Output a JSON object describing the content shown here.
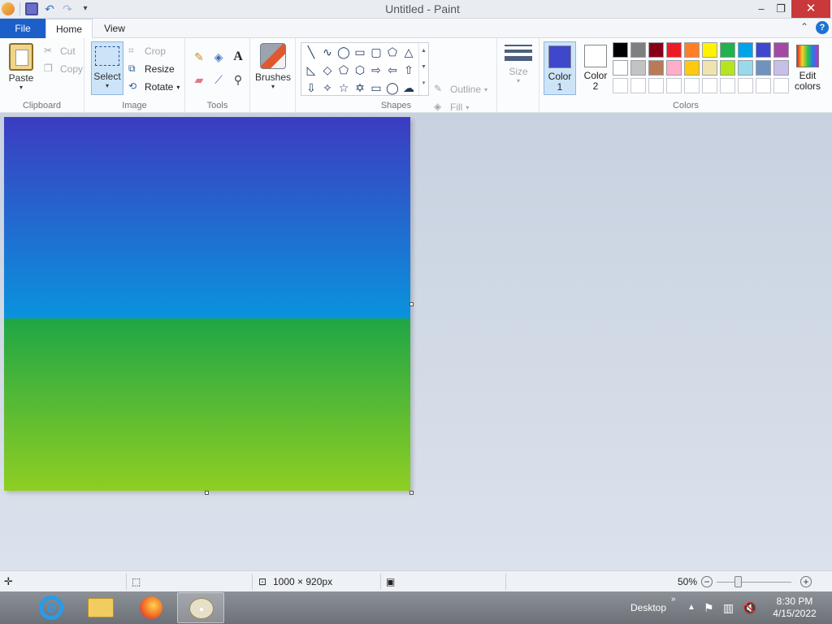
{
  "window": {
    "title": "Untitled - Paint",
    "minimize": "–",
    "maximize": "❐",
    "close": "✕"
  },
  "quick_access": {
    "undo": "↶",
    "redo": "↷",
    "more": "▾"
  },
  "tabs": [
    {
      "label": "File"
    },
    {
      "label": "Home"
    },
    {
      "label": "View"
    }
  ],
  "ribbon_controls": {
    "collapse": "⌃",
    "help": "?"
  },
  "ribbon": {
    "clipboard": {
      "label": "Clipboard",
      "paste": "Paste",
      "cut": "Cut",
      "copy": "Copy"
    },
    "image": {
      "label": "Image",
      "select": "Select",
      "crop": "Crop",
      "resize": "Resize",
      "rotate": "Rotate"
    },
    "tools": {
      "label": "Tools"
    },
    "brushes": {
      "label": "Brushes"
    },
    "shapes": {
      "label": "Shapes",
      "outline": "Outline",
      "fill": "Fill"
    },
    "size": {
      "label": "Size"
    },
    "colors": {
      "label": "Colors",
      "color1_line1": "Color",
      "color1_line2": "1",
      "color2_line1": "Color",
      "color2_line2": "2",
      "edit_line1": "Edit",
      "edit_line2": "colors",
      "color1_value": "#3f48cc",
      "color2_value": "#ffffff",
      "palette": [
        "#000000",
        "#7f7f7f",
        "#880015",
        "#ed1c24",
        "#ff7f27",
        "#fff200",
        "#22b14c",
        "#00a2e8",
        "#3f48cc",
        "#a349a4",
        "#ffffff",
        "#c3c3c3",
        "#b97a57",
        "#ffaec9",
        "#ffc90e",
        "#efe4b0",
        "#b5e61d",
        "#99d9ea",
        "#7092be",
        "#c8bfe7",
        "#ffffff",
        "#ffffff",
        "#ffffff",
        "#ffffff",
        "#ffffff",
        "#ffffff",
        "#ffffff",
        "#ffffff",
        "#ffffff",
        "#ffffff"
      ]
    }
  },
  "status": {
    "dimensions": "1000 × 920px",
    "zoom": "50%",
    "zoom_out": "−",
    "zoom_in": "+",
    "zoom_level": 0.5
  },
  "taskbar": {
    "desktop": "Desktop",
    "chevron": "»",
    "time": "8:30 PM",
    "date": "4/15/2022"
  }
}
